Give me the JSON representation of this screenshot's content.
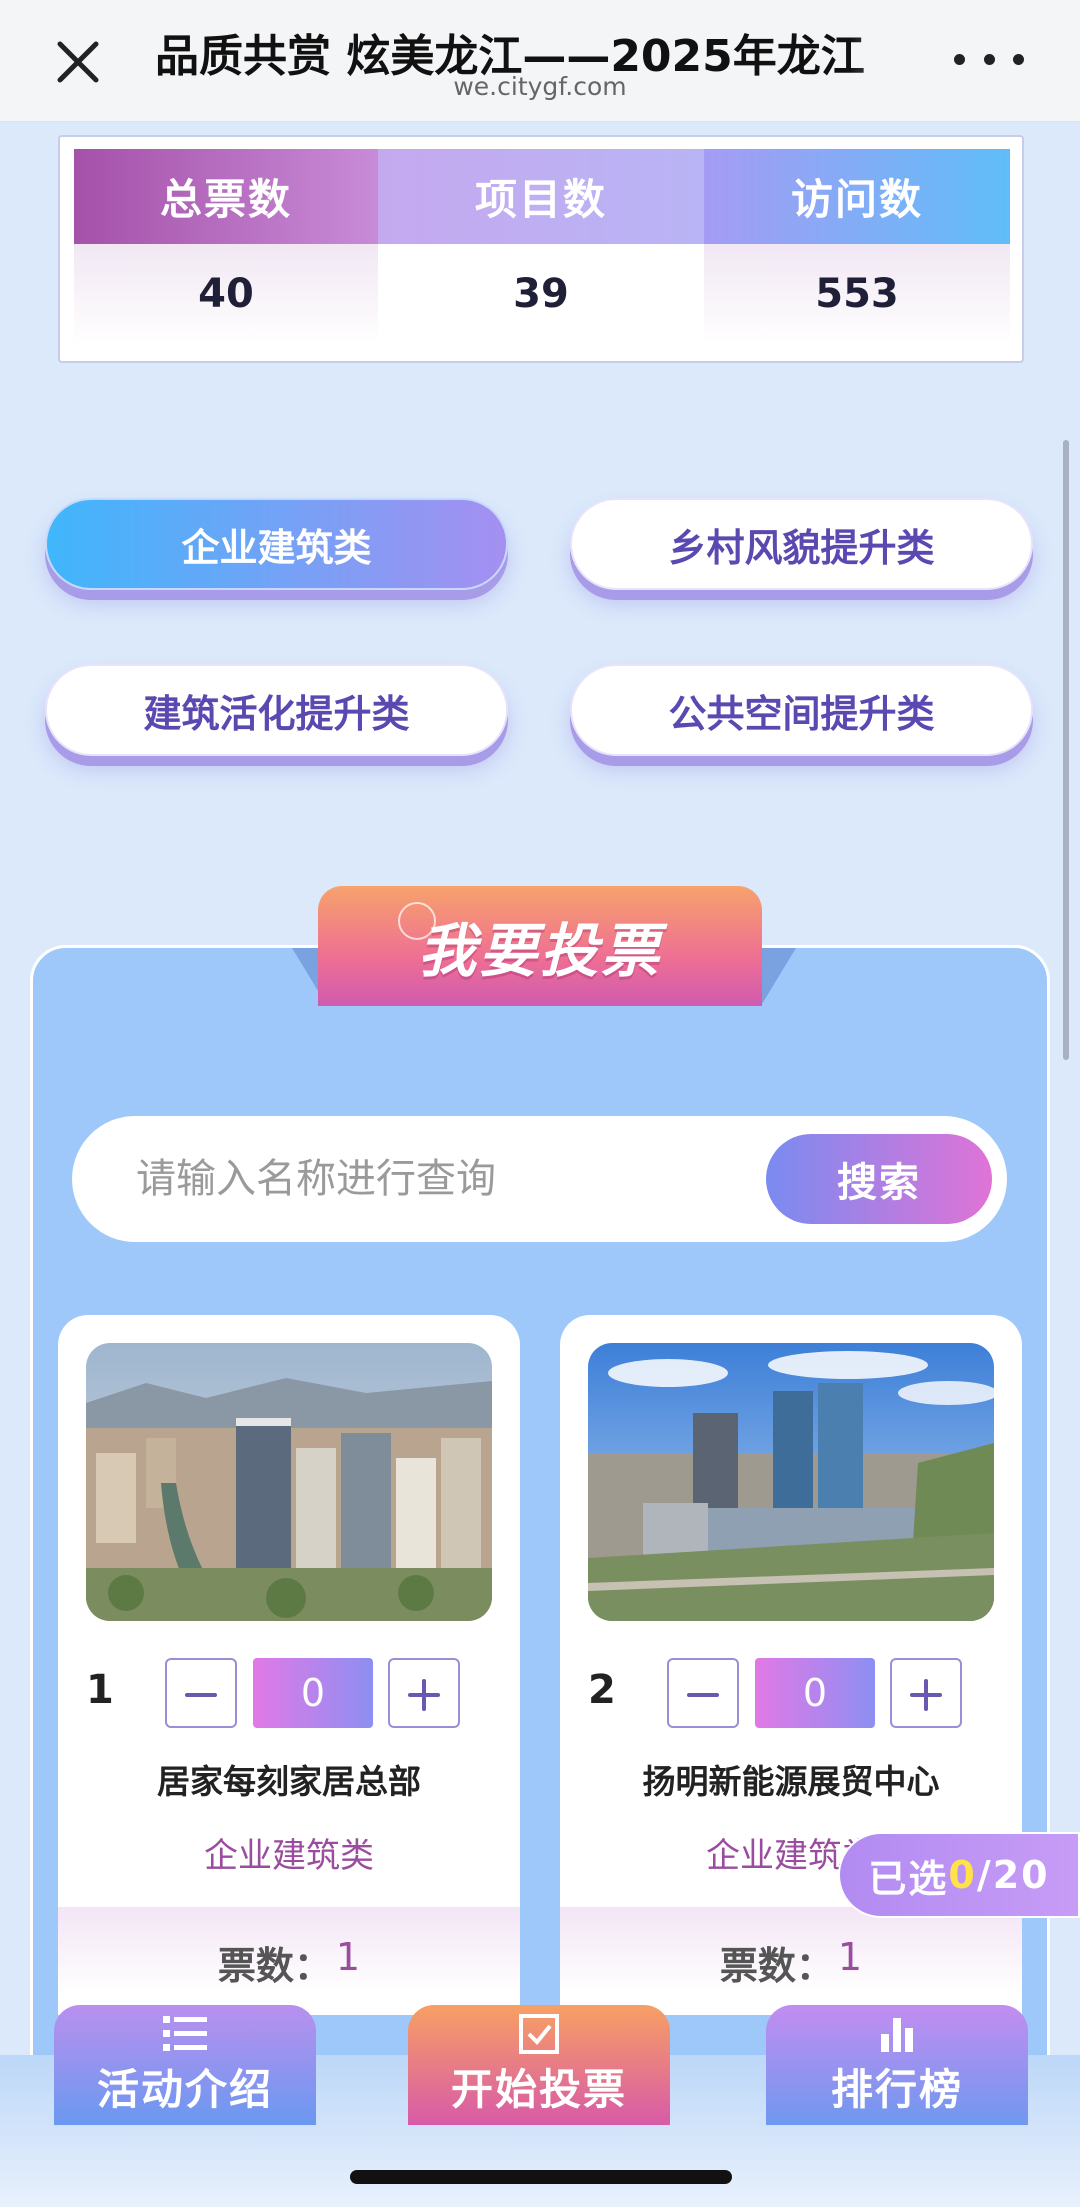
{
  "header": {
    "title": "品质共赏 炫美龙江——2025年龙江",
    "domain": "we.citygf.com",
    "close_icon": "close-icon",
    "more_icon": "more-icon"
  },
  "stats": {
    "labels": [
      "总票数",
      "项目数",
      "访问数"
    ],
    "values": [
      "40",
      "39",
      "553"
    ]
  },
  "categories": [
    {
      "label": "企业建筑类",
      "active": true
    },
    {
      "label": "乡村风貌提升类",
      "active": false
    },
    {
      "label": "建筑活化提升类",
      "active": false
    },
    {
      "label": "公共空间提升类",
      "active": false
    }
  ],
  "vote": {
    "title": "我要投票",
    "search_placeholder": "请输入名称进行查询",
    "search_value": "",
    "search_button": "搜索"
  },
  "cards": [
    {
      "rank": "1",
      "count": "0",
      "name": "居家每刻家居总部",
      "category": "企业建筑类",
      "votes_label": "票数：",
      "votes": "1"
    },
    {
      "rank": "2",
      "count": "0",
      "name": "扬明新能源展贸中心",
      "category": "企业建筑类",
      "votes_label": "票数：",
      "votes": "1"
    }
  ],
  "selected": {
    "prefix": "已选",
    "count": "0",
    "suffix": "/20"
  },
  "nav": [
    {
      "label": "活动介绍",
      "icon": "list-icon"
    },
    {
      "label": "开始投票",
      "icon": "checkbox-icon"
    },
    {
      "label": "排行榜",
      "icon": "bar-chart-icon"
    }
  ],
  "colors": {
    "accent_purple": "#9a4c9e",
    "accent_blue": "#3fb6fb",
    "vote_orange": "#f7a26c",
    "highlight_yellow": "#ffe14a"
  }
}
